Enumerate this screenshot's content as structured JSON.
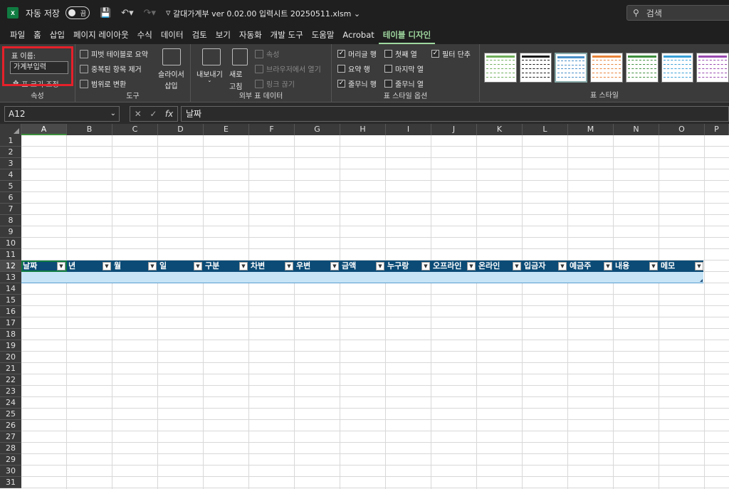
{
  "titlebar": {
    "app_badge": "x",
    "autosave_label": "자동 저장",
    "autosave_state": "끔",
    "doc_title": "갈대가계부 ver 0.02.00 입력시트 20250511.xlsm",
    "search_placeholder": "검색"
  },
  "tabs": [
    "파일",
    "홈",
    "삽입",
    "페이지 레이아웃",
    "수식",
    "데이터",
    "검토",
    "보기",
    "자동화",
    "개발 도구",
    "도움말",
    "Acrobat",
    "테이블 디자인"
  ],
  "active_tab": "테이블 디자인",
  "ribbon": {
    "properties": {
      "name_label": "표 이름:",
      "name_value": "가계부입력",
      "resize_label": "표 크기 조정",
      "group_label": "속성"
    },
    "tools": {
      "pivot": "피벗 테이블로 요약",
      "remove_dup": "중복된 항목 제거",
      "to_range": "범위로 변환",
      "slicer_line1": "슬라이서",
      "slicer_line2": "삽입",
      "group_label": "도구"
    },
    "external": {
      "export": "내보내기",
      "refresh_line1": "새로",
      "refresh_line2": "고침",
      "properties": "속성",
      "open_browser": "브라우저에서 열기",
      "unlink": "링크 끊기",
      "group_label": "외부 표 데이터"
    },
    "style_options": {
      "header_row": "머리글 행",
      "total_row": "요약 행",
      "banded_rows": "줄무늬 행",
      "first_col": "첫째 열",
      "last_col": "마지막 열",
      "banded_cols": "줄무늬 열",
      "filter_btn": "필터 단추",
      "group_label": "표 스타일 옵션"
    },
    "styles": {
      "group_label": "표 스타일",
      "swatch_colors": [
        "#6fae5a",
        "#1a1a1a",
        "#4a90c8",
        "#e8833a",
        "#3e8e3e",
        "#3aa0d8",
        "#9a4ab0"
      ]
    }
  },
  "formula_bar": {
    "name_box": "A12",
    "fx": "fx",
    "content": "날짜"
  },
  "sheet": {
    "columns": [
      "A",
      "B",
      "C",
      "D",
      "E",
      "F",
      "G",
      "H",
      "I",
      "J",
      "K",
      "L",
      "M",
      "N",
      "O",
      "P"
    ],
    "rows": [
      "1",
      "2",
      "3",
      "4",
      "5",
      "6",
      "7",
      "8",
      "9",
      "10",
      "11",
      "12",
      "13",
      "14",
      "15",
      "16",
      "17",
      "18",
      "19",
      "20",
      "21",
      "22",
      "23",
      "24",
      "25",
      "26",
      "27",
      "28",
      "29",
      "30",
      "31"
    ],
    "table_headers": [
      "날짜",
      "년",
      "월",
      "일",
      "구분",
      "차변",
      "우변",
      "금액",
      "누구랑",
      "오프라인",
      "온라인",
      "입금자",
      "예금주",
      "내용",
      "메모"
    ],
    "header_color": "#0b4b76",
    "row_color": "#c6e4f6"
  }
}
